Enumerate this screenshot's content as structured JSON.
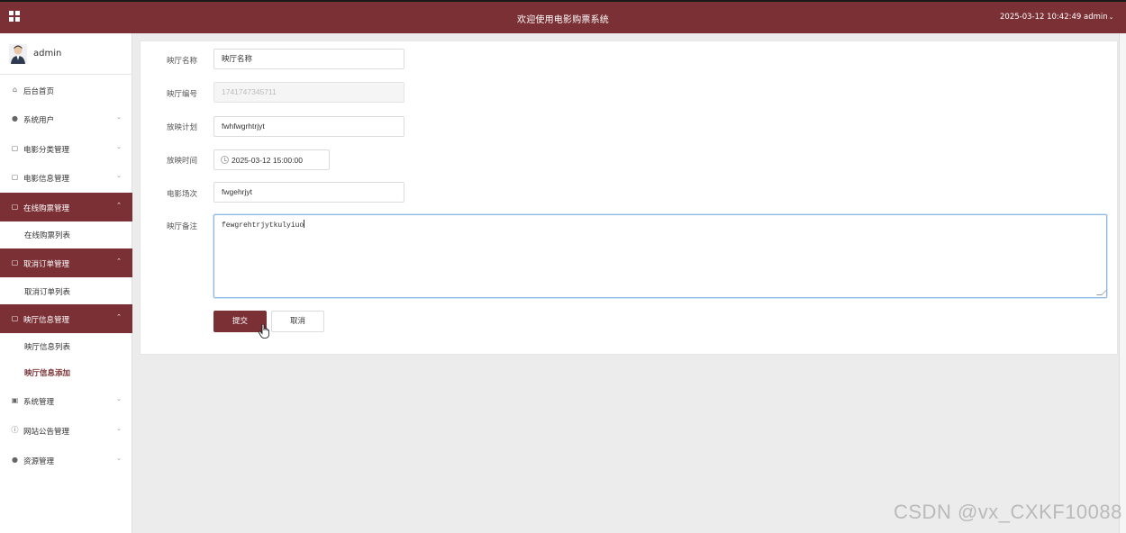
{
  "header": {
    "title": "欢迎使用电影购票系统",
    "datetime": "2025-03-12 10:42:49",
    "user": "admin",
    "menu_icon": "grid-icon",
    "accent_color": "#7a3035"
  },
  "sidebar": {
    "profile_name": "admin",
    "items": [
      {
        "label": "后台首页",
        "icon": "home-icon"
      },
      {
        "label": "系统用户",
        "icon": "user-icon"
      },
      {
        "label": "电影分类管理",
        "icon": "doc-icon"
      },
      {
        "label": "电影信息管理",
        "icon": "doc-icon"
      },
      {
        "label": "在线购票管理",
        "icon": "doc-icon"
      },
      {
        "label": "在线购票列表"
      },
      {
        "label": "取消订单管理",
        "icon": "doc-icon"
      },
      {
        "label": "取消订单列表"
      },
      {
        "label": "映厅信息管理",
        "icon": "doc-icon"
      },
      {
        "label": "映厅信息列表"
      },
      {
        "label": "映厅信息添加"
      },
      {
        "label": "系统管理",
        "icon": "image-icon"
      },
      {
        "label": "网站公告管理",
        "icon": "info-icon"
      },
      {
        "label": "资源管理",
        "icon": "location-icon"
      }
    ]
  },
  "form": {
    "fields": [
      {
        "label": "映厅名称",
        "value": "映厅名称"
      },
      {
        "label": "映厅编号",
        "value": "1741747345711"
      },
      {
        "label": "放映计划",
        "value": "fwhfwgrhtrjyt"
      },
      {
        "label": "放映时间",
        "value": "2025-03-12 15:00:00"
      },
      {
        "label": "电影场次",
        "value": "fwgehrjyt"
      },
      {
        "label": "映厅备注",
        "value": "fewgrehtrjytkulyiuo"
      }
    ],
    "submit_label": "提交",
    "cancel_label": "取消"
  },
  "watermark": "CSDN @vx_CXKF10088"
}
